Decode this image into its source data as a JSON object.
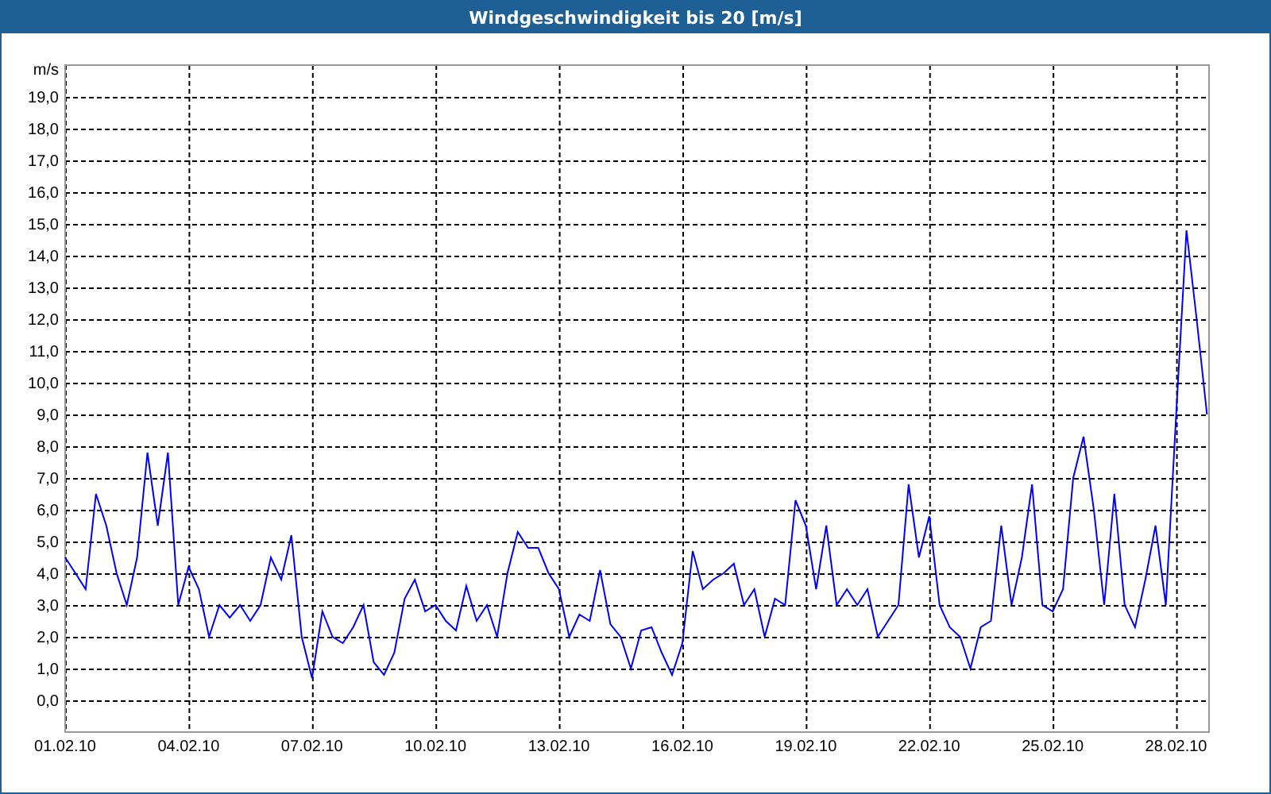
{
  "chart_data": {
    "type": "line",
    "title": "Windgeschwindigkeit bis 20 [m/s]",
    "ylabel": "m/s",
    "categories": [
      "01.02.10",
      null,
      null,
      null,
      null,
      null,
      null,
      null,
      null,
      null,
      null,
      null,
      "04.02.10",
      null,
      null,
      null,
      null,
      null,
      null,
      null,
      null,
      null,
      null,
      null,
      "07.02.10",
      null,
      null,
      null,
      null,
      null,
      null,
      null,
      null,
      null,
      null,
      null,
      "10.02.10",
      null,
      null,
      null,
      null,
      null,
      null,
      null,
      null,
      null,
      null,
      null,
      "13.02.10",
      null,
      null,
      null,
      null,
      null,
      null,
      null,
      null,
      null,
      null,
      null,
      "16.02.10",
      null,
      null,
      null,
      null,
      null,
      null,
      null,
      null,
      null,
      null,
      null,
      "19.02.10",
      null,
      null,
      null,
      null,
      null,
      null,
      null,
      null,
      null,
      null,
      null,
      "22.02.10",
      null,
      null,
      null,
      null,
      null,
      null,
      null,
      null,
      null,
      null,
      null,
      "25.02.10",
      null,
      null,
      null,
      null,
      null,
      null,
      null,
      null,
      null,
      null,
      null,
      "28.02.10",
      null,
      null,
      null
    ],
    "series": [
      {
        "color": "#0000ff",
        "values": [
          4.5,
          4.0,
          3.5,
          6.5,
          5.5,
          4.0,
          3.0,
          4.5,
          7.8,
          5.5,
          7.8,
          3.0,
          4.2,
          3.5,
          2.0,
          3.0,
          2.6,
          3.0,
          2.5,
          3.0,
          4.5,
          3.8,
          5.2,
          2.0,
          0.7,
          2.8,
          2.0,
          1.8,
          2.3,
          3.0,
          1.2,
          0.8,
          1.5,
          3.2,
          3.8,
          2.8,
          3.0,
          2.5,
          2.2,
          3.6,
          2.5,
          3.0,
          2.0,
          4.0,
          5.3,
          4.8,
          4.8,
          4.0,
          3.5,
          2.0,
          2.7,
          2.5,
          4.1,
          2.4,
          2.0,
          1.0,
          2.2,
          2.3,
          1.5,
          0.8,
          1.8,
          4.7,
          3.5,
          3.8,
          4.0,
          4.3,
          3.0,
          3.5,
          2.0,
          3.2,
          3.0,
          6.3,
          5.5,
          3.5,
          5.5,
          3.0,
          3.5,
          3.0,
          3.5,
          2.0,
          2.5,
          3.0,
          6.8,
          4.5,
          5.8,
          3.0,
          2.3,
          2.0,
          1.0,
          2.3,
          2.5,
          5.5,
          3.0,
          4.5,
          6.8,
          3.0,
          2.8,
          3.5,
          7.0,
          8.3,
          6.0,
          3.0,
          6.5,
          3.0,
          2.3,
          3.8,
          5.5,
          3.0,
          9.0,
          14.8,
          12.0,
          9.0
        ]
      }
    ],
    "ylim": [
      -1,
      20
    ],
    "grid": true,
    "yticks": [
      {
        "value": 0,
        "label": "0,0"
      },
      {
        "value": 1,
        "label": "1,0"
      },
      {
        "value": 2,
        "label": "2,0"
      },
      {
        "value": 3,
        "label": "3,0"
      },
      {
        "value": 4,
        "label": "4,0"
      },
      {
        "value": 5,
        "label": "5,0"
      },
      {
        "value": 6,
        "label": "6,0"
      },
      {
        "value": 7,
        "label": "7,0"
      },
      {
        "value": 8,
        "label": "8,0"
      },
      {
        "value": 9,
        "label": "9,0"
      },
      {
        "value": 10,
        "label": "10,0"
      },
      {
        "value": 11,
        "label": "11,0"
      },
      {
        "value": 12,
        "label": "12,0"
      },
      {
        "value": 13,
        "label": "13,0"
      },
      {
        "value": 14,
        "label": "14,0"
      },
      {
        "value": 15,
        "label": "15,0"
      },
      {
        "value": 16,
        "label": "16,0"
      },
      {
        "value": 17,
        "label": "17,0"
      },
      {
        "value": 18,
        "label": "18,0"
      },
      {
        "value": 19,
        "label": "19,0"
      }
    ]
  }
}
